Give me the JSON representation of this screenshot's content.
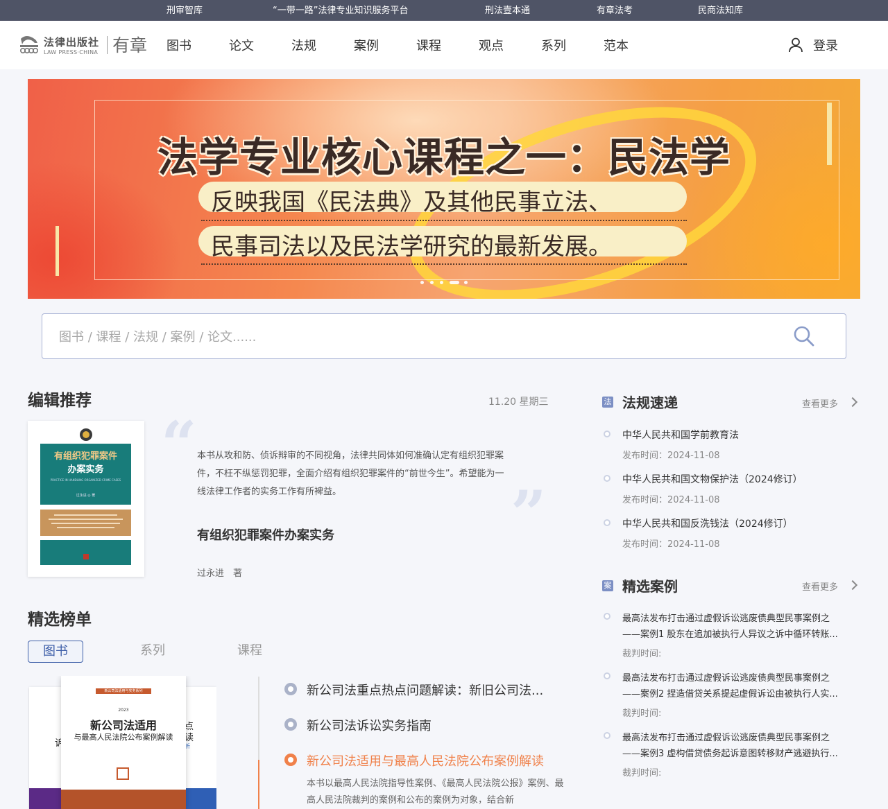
{
  "topbar": {
    "links": [
      "刑审智库",
      "“一带一路”法律专业知识服务平台",
      "刑法壹本通",
      "有章法考",
      "民商法知库"
    ]
  },
  "header": {
    "logo_cn": "法律出版社",
    "logo_en": "LAW PRESS·CHINA",
    "logo_brand": "有章",
    "nav": [
      "图书",
      "论文",
      "法规",
      "案例",
      "课程",
      "观点",
      "系列",
      "范本"
    ],
    "login_label": "登录"
  },
  "banner": {
    "title": "法学专业核心课程之一：民法学",
    "line1": "反映我国《民法典》及其他民事立法、",
    "line2": "民事司法以及民法学研究的最新发展。",
    "slide_count": 5,
    "active_slide": 4
  },
  "search": {
    "placeholder": "图书 / 课程 / 法规 / 案例 / 论文......"
  },
  "editor_pick": {
    "heading": "编辑推荐",
    "date": "11.20 星期三",
    "description": "本书从攻和防、侦诉辩审的不同视角，法律共同体如何准确认定有组织犯罪案件，不枉不纵惩罚犯罪，全面介绍有组织犯罪案件的“前世今生”。希望能为一线法律工作者的实务工作有所裨益。",
    "book_title": "有组织犯罪案件办案实务",
    "author": "过永进　著",
    "cover": {
      "title_line1": "有组织犯罪案件",
      "title_line2": "办案实务",
      "subtitle": "PRACTICE IN HANDLING ORGANIZED CRIME CASES",
      "author": "过永进 ◎ 著"
    }
  },
  "ranking": {
    "heading": "精选榜单",
    "tabs": [
      "图书",
      "系列",
      "课程"
    ],
    "active_tab": 0,
    "items": [
      "新公司法重点热点问题解读：新旧公司法...",
      "新公司法诉讼实务指南",
      "新公司法适用与最高人民法院公布案例解读"
    ],
    "active_item": 2,
    "active_desc": "本书以最高人民法院指导性案例、《最高人民法院公报》案例、最高人民法院裁判的案例和公布的案例为对象，结合新",
    "cover": {
      "series": "新公司法适用与实务系列",
      "year": "2023",
      "title_line1": "新公司法适用",
      "title_line2": "与最高人民法院公布案例解读",
      "left_char": "诉",
      "right_chars": [
        "点",
        "读",
        "析"
      ]
    }
  },
  "regulations": {
    "heading": "法规速递",
    "badge": "法",
    "more_label": "查看更多",
    "date_prefix": "发布时间：",
    "items": [
      {
        "title": "中华人民共和国学前教育法",
        "date": "发布时间：2024-11-08"
      },
      {
        "title": "中华人民共和国文物保护法（2024修订）",
        "date": "发布时间：2024-11-08"
      },
      {
        "title": "中华人民共和国反洗钱法（2024修订）",
        "date": "发布时间：2024-11-08"
      }
    ]
  },
  "cases": {
    "heading": "精选案例",
    "badge": "案",
    "more_label": "查看更多",
    "items": [
      {
        "line1": "最高法发布打击通过虚假诉讼逃废债典型民事案例之",
        "line2": "——案例1 股东在追加被执行人异议之诉中循环转账...",
        "meta": "裁判时间:"
      },
      {
        "line1": "最高法发布打击通过虚假诉讼逃废债典型民事案例之",
        "line2": "——案例2 捏造借贷关系提起虚假诉讼由被执行人实...",
        "meta": "裁判时间:"
      },
      {
        "line1": "最高法发布打击通过虚假诉讼逃废债典型民事案例之",
        "line2": "——案例3 虚构借贷债务起诉意图转移财产逃避执行...",
        "meta": "裁判时间:"
      }
    ]
  },
  "colors": {
    "topbar": "#4f5466",
    "accent_blue": "#3d5ea8",
    "accent_orange": "#f0814a",
    "cover_teal": "#187c7a"
  }
}
